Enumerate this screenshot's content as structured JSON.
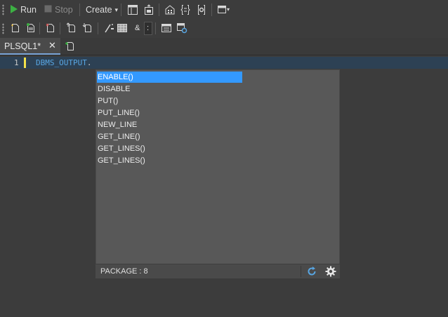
{
  "toolbar": {
    "run_label": "Run",
    "stop_label": "Stop",
    "create_label": "Create",
    "create_caret": "▾",
    "amp_label": "&",
    "colon_label": ":"
  },
  "tabs": [
    {
      "label": "PLSQL1*",
      "close": "✕"
    }
  ],
  "editor": {
    "line_number": "1",
    "code": "DBMS_OUTPUT",
    "code_suffix": "."
  },
  "autocomplete": {
    "items": [
      {
        "label": "ENABLE()",
        "selected": true
      },
      {
        "label": "DISABLE",
        "selected": false
      },
      {
        "label": "PUT()",
        "selected": false
      },
      {
        "label": "PUT_LINE()",
        "selected": false
      },
      {
        "label": "NEW_LINE",
        "selected": false
      },
      {
        "label": "GET_LINE()",
        "selected": false
      },
      {
        "label": "GET_LINES()",
        "selected": false
      },
      {
        "label": "GET_LINES()",
        "selected": false
      }
    ],
    "status": "PACKAGE : 8"
  },
  "colors": {
    "background": "#3c3c3c",
    "selection": "#3399ff",
    "keyword": "#58a6e3",
    "line_marker": "#f2e04a",
    "run_green": "#3cb043"
  }
}
